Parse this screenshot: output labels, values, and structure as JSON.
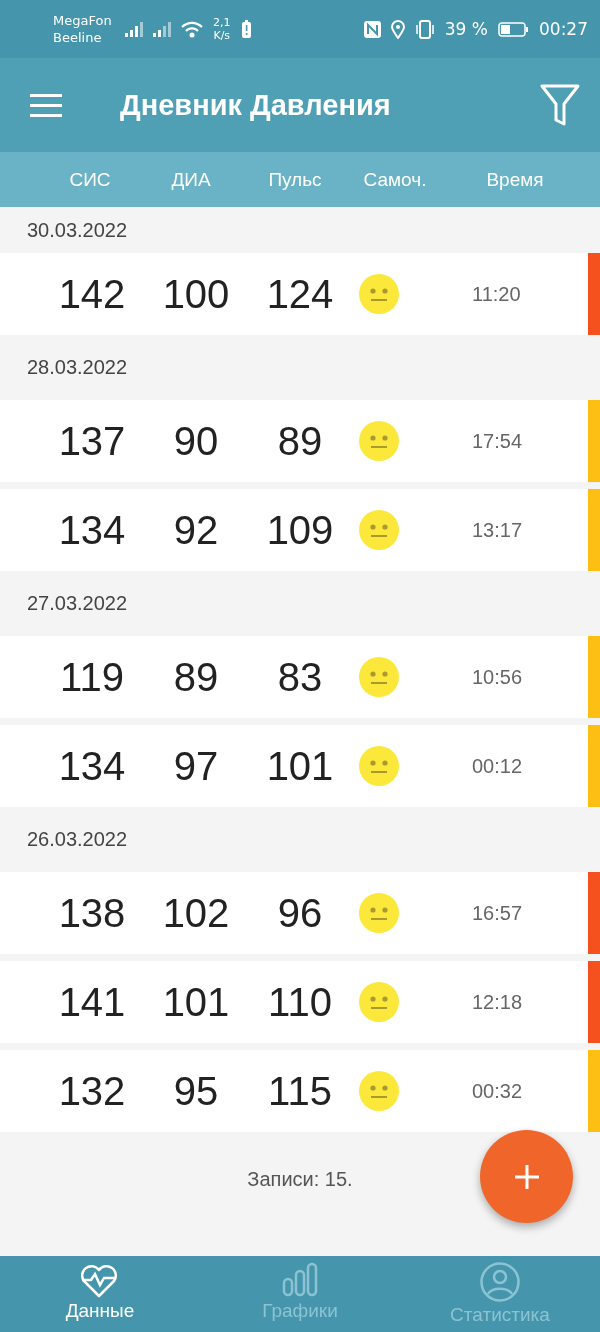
{
  "status_bar": {
    "carriers": [
      "MegaFon",
      "Beeline"
    ],
    "speed": [
      "2,1",
      "K/s"
    ],
    "battery": "39 %",
    "time": "00:27"
  },
  "app_bar": {
    "title": "Дневник Давления"
  },
  "columns": [
    "СИС",
    "ДИА",
    "Пульс",
    "Самоч.",
    "Время"
  ],
  "groups": [
    {
      "date": "30.03.2022",
      "rows": [
        {
          "sys": "142",
          "dia": "100",
          "pulse": "124",
          "time": "11:20",
          "color": "#f4511e"
        }
      ]
    },
    {
      "date": "28.03.2022",
      "rows": [
        {
          "sys": "137",
          "dia": "90",
          "pulse": "89",
          "time": "17:54",
          "color": "#fdbf14"
        },
        {
          "sys": "134",
          "dia": "92",
          "pulse": "109",
          "time": "13:17",
          "color": "#fdbf14"
        }
      ]
    },
    {
      "date": "27.03.2022",
      "rows": [
        {
          "sys": "119",
          "dia": "89",
          "pulse": "83",
          "time": "10:56",
          "color": "#fdbf14"
        },
        {
          "sys": "134",
          "dia": "97",
          "pulse": "101",
          "time": "00:12",
          "color": "#fdbf14"
        }
      ]
    },
    {
      "date": "26.03.2022",
      "rows": [
        {
          "sys": "138",
          "dia": "102",
          "pulse": "96",
          "time": "16:57",
          "color": "#f4511e"
        },
        {
          "sys": "141",
          "dia": "101",
          "pulse": "110",
          "time": "12:18",
          "color": "#f4511e"
        },
        {
          "sys": "132",
          "dia": "95",
          "pulse": "115",
          "time": "00:32",
          "color": "#fdbf14"
        }
      ]
    }
  ],
  "footer": {
    "count": "Записи: 15."
  },
  "bottom_nav": [
    {
      "label": "Данные",
      "selected": true
    },
    {
      "label": "Графики",
      "selected": false
    },
    {
      "label": "Статистика",
      "selected": false
    }
  ]
}
